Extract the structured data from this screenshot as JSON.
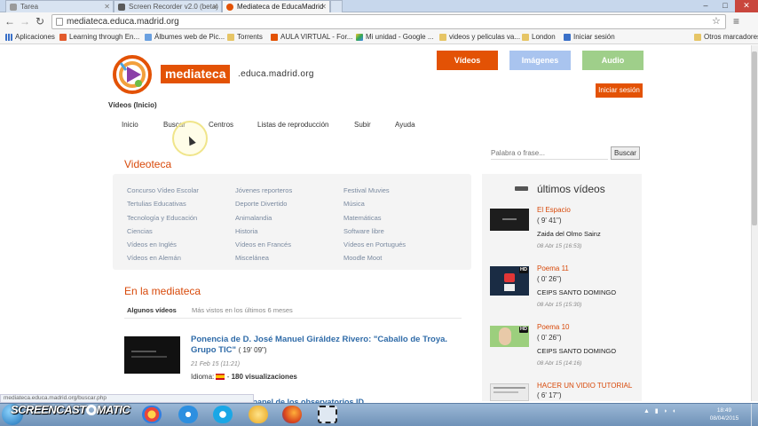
{
  "browser": {
    "tabs": [
      {
        "label": "Tarea",
        "active": false
      },
      {
        "label": "Screen Recorder v2.0 (beta)",
        "active": false
      },
      {
        "label": "Mediateca de EducaMadrid",
        "active": true
      }
    ],
    "url": "mediateca.educa.madrid.org",
    "bookmarks": [
      "Aplicaciones",
      "Learning through En...",
      "Álbumes web de Pic...",
      "Torrents",
      "AULA VIRTUAL - For...",
      "Mi unidad - Google ...",
      "videos y peliculas va...",
      "London",
      "Iniciar sesión"
    ],
    "bookmarks_other": "Otros marcadores"
  },
  "site": {
    "logo_word": "mediateca",
    "logo_domain": ".educa.madrid.org",
    "top_buttons": [
      "Vídeos",
      "Imágenes",
      "Audio"
    ],
    "login": "Iniciar sesión",
    "page_crumb": "Vídeos (Inicio)",
    "nav": [
      "Inicio",
      "Buscar",
      "Centros",
      "Listas de reproducción",
      "Subir",
      "Ayuda"
    ],
    "search_placeholder": "Palabra o frase...",
    "search_button": "Buscar"
  },
  "videoteca": {
    "title": "Videoteca",
    "col1": [
      "Concurso Vídeo Escolar",
      "Tertulias Educativas",
      "Tecnología y Educación",
      "Ciencias",
      "Vídeos en Inglés",
      "Vídeos en Alemán"
    ],
    "col2": [
      "Jóvenes reporteros",
      "Deporte Divertido",
      "Animalandia",
      "Historia",
      "Vídeos en Francés",
      "Miscelánea"
    ],
    "col3": [
      "Festival Muvies",
      "Música",
      "Matemáticas",
      "Software libre",
      "Vídeos en Portugués",
      "Moodle Moot"
    ]
  },
  "mediateca": {
    "title": "En la mediateca",
    "tabs": [
      "Algunos vídeos",
      "Más vistos en los últimos 6 meses"
    ],
    "featured": {
      "title": "Ponencia de D. José Manuel Giráldez Rivero: \"Caballo de Troya. Grupo TIC\"",
      "duration": "( 19' 09\")",
      "date": "21 Feb 15 (11:21)",
      "idioma_label": "Idioma:",
      "views": "180 visualizaciones"
    },
    "next_title": "... Campaña - El papel de los observatorios ID..."
  },
  "sidebar": {
    "title": "últimos vídeos",
    "items": [
      {
        "title": "El Espacio",
        "duration": "( 9' 41\")",
        "author": "Zaida del Olmo Sainz",
        "date": "08 Abr 15 (16:53)"
      },
      {
        "title": "Poema 11",
        "duration": "( 0' 26\")",
        "author": "CEIPS SANTO DOMINGO",
        "date": "08 Abr 15 (15:30)"
      },
      {
        "title": "Poema 10",
        "duration": "( 0' 26\")",
        "author": "CEIPS SANTO DOMINGO",
        "date": "08 Abr 15 (14:16)"
      },
      {
        "title": "HACER UN VIDIO TUTORIAL",
        "duration": "( 6' 17\")"
      }
    ],
    "hd": "HD"
  },
  "status_url": "mediateca.educa.madrid.org/buscar.php",
  "taskbar": {
    "recorder": "SCREENCAST",
    "recorder2": "MATIC",
    "time": "18:49",
    "date": "08/04/2015"
  },
  "colors": {
    "accent": "#e35205",
    "videos_btn": "#e35205",
    "imagenes_btn": "#a9c4ef",
    "audio_btn": "#9fcf8a",
    "link": "#2f6ba8"
  }
}
